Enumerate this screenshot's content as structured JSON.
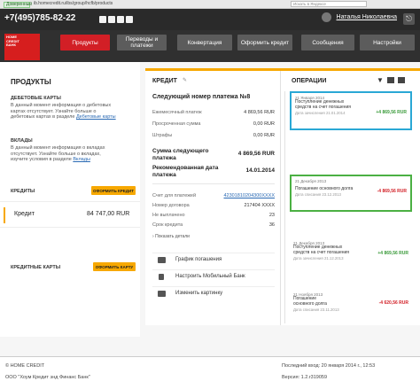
{
  "browser": {
    "secure_label": "Доверенный",
    "url": "ib.homecredit.ru/ibs/group/hcfb/products",
    "search_placeholder": "Искать в Яндексе"
  },
  "topbar": {
    "phone": "+7(495)785-82-22",
    "user_name": "Наталья Николаевна",
    "exit_icon": "logout-icon"
  },
  "logo": {
    "line1": "HOME",
    "line2": "CREDIT",
    "line3": "БАНК"
  },
  "nav": [
    {
      "label": "Продукты"
    },
    {
      "label": "Переводы и платежи"
    },
    {
      "label": "Конвертация"
    },
    {
      "label": "Оформить кредит"
    },
    {
      "label": "Сообщения"
    },
    {
      "label": "Настройки"
    }
  ],
  "left": {
    "title": "ПРОДУКТЫ",
    "debit_title": "ДЕБЕТОВЫЕ КАРТЫ",
    "debit_text_1": "В данный момент информация о дебетовых",
    "debit_text_2": "картах отсутствует. Узнайте больше о",
    "debit_text_3": "дебетовых картах в разделе",
    "debit_link": "Дебетовые карты",
    "deposits_title": "ВКЛАДЫ",
    "dep_text_1": "В данный момент информация о вкладах",
    "dep_text_2": "отсутствует. Узнайте больше о вкладах,",
    "dep_text_3": "изучите условия в разделе",
    "dep_link": "Вклады",
    "credits_title": "КРЕДИТЫ",
    "credits_button": "ОФОРМИТЬ КРЕДИТ",
    "credit_item": "Кредит",
    "credit_amount": "84 747,00 RUR",
    "credit_cards_title": "КРЕДИТНЫЕ КАРТЫ",
    "credit_cards_button": "ОФОРМИТЬ КАРТУ"
  },
  "credit": {
    "title": "КРЕДИТ",
    "next_payment": "Следующий номер платежа №8",
    "rows": [
      {
        "label": "Ежемесячный платеж",
        "value": "4 869,56 RUR"
      },
      {
        "label": "Просроченная сумма",
        "value": "0,00 RUR"
      },
      {
        "label": "Штрафы",
        "value": "0,00 RUR"
      }
    ],
    "next_sum_label_1": "Сумма следующего",
    "next_sum_label_2": "платежа",
    "next_sum_value": "4 869,56 RUR",
    "rec_date_label_1": "Рекомендованная дата",
    "rec_date_label_2": "платежа",
    "rec_date_value": "14.01.2014",
    "details": [
      {
        "label": "Счет для платежей",
        "value": "42301810204300XXXX"
      },
      {
        "label": "Номер договора",
        "value": "217404 XXXX"
      },
      {
        "label": "Не выплачено",
        "value": "23"
      },
      {
        "label": "Срок кредита",
        "value": "36"
      }
    ],
    "show_details": "Показать детали",
    "actions": [
      {
        "label": "График погашения",
        "icon": "calendar-icon"
      },
      {
        "label": "Настроить Мобильный Банк",
        "icon": "phone-icon"
      },
      {
        "label": "Изменить картинку",
        "icon": "image-icon"
      }
    ]
  },
  "ops": {
    "title": "ОПЕРАЦИИ",
    "items": [
      {
        "date": "21 Января 2014",
        "desc_1": "Поступление денежных",
        "desc_2": "средств на счет погашения",
        "amount": "+4 869,56 RUR",
        "hint": "Дата зачисления 21.01.2014"
      },
      {
        "date": "21 Декабря 2013",
        "desc_1": "Погашение основного долга",
        "desc_2": "",
        "amount": "-4 869,56 RUR",
        "hint": "Дата списания 23.12.2013"
      },
      {
        "date": "21 Декабря 2013",
        "desc_1": "Поступление денежных",
        "desc_2": "средств на счет погашения",
        "amount": "+4 869,56 RUR",
        "hint": "Дата зачисления 21.12.2013"
      },
      {
        "date": "21 Ноября 2013",
        "desc_1": "Погашение",
        "desc_2": "основного долга",
        "amount": "-4 620,56 RUR",
        "hint": "Дата списания 23.11.2013"
      }
    ]
  },
  "footer": {
    "copyright": "© HOME CREDIT",
    "company": "ООО \"Хоум Кредит энд Финанс Банк\"",
    "last_login": "Последний вход: 20 января 2014 г., 12:53",
    "version": "Версия: 1.2.r319059"
  }
}
